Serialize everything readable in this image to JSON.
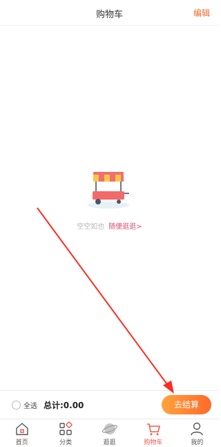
{
  "header": {
    "title": "购物车",
    "edit_label": "编辑"
  },
  "empty": {
    "text": "空空如也",
    "link": "随便逛逛>"
  },
  "checkout": {
    "select_all": "全选",
    "total": "总计:0.00",
    "button": "去结算"
  },
  "tabbar": {
    "items": [
      {
        "label": "首页",
        "icon": "home-icon",
        "active": false
      },
      {
        "label": "分类",
        "icon": "category-icon",
        "active": false
      },
      {
        "label": "逛逛",
        "icon": "planet-icon",
        "active": false
      },
      {
        "label": "购物车",
        "icon": "cart-icon",
        "active": true
      },
      {
        "label": "我的",
        "icon": "user-icon",
        "active": false
      }
    ]
  },
  "colors": {
    "accent": "#f06a2b",
    "link": "#e04b6a",
    "active_tab": "#f05a4a"
  }
}
